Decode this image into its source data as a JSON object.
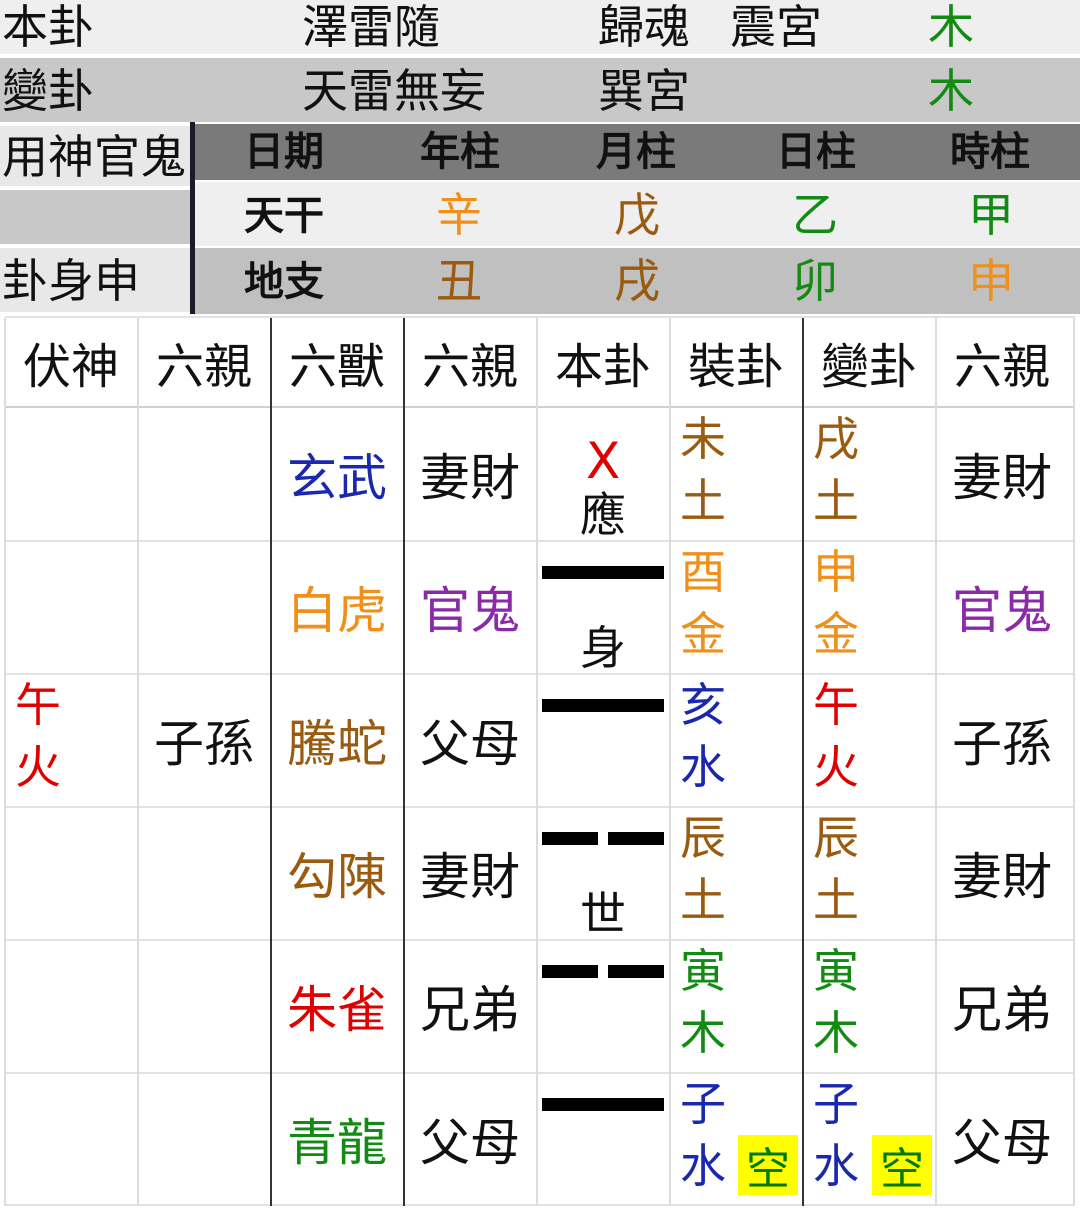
{
  "header": {
    "row1": {
      "label": "本卦",
      "name": "澤雷隨",
      "type": "歸魂",
      "palace": "震宮",
      "element": "木"
    },
    "row2": {
      "label": "變卦",
      "name": "天雷無妄",
      "palace": "巽宮",
      "element": "木"
    },
    "row3": {
      "label": "用神官鬼"
    },
    "row5": {
      "label": "卦身申"
    },
    "pillars": {
      "headers": [
        "日期",
        "年柱",
        "月柱",
        "日柱",
        "時柱"
      ],
      "stem_label": "天干",
      "stems": [
        "辛",
        "戊",
        "乙",
        "甲"
      ],
      "branch_label": "地支",
      "branches": [
        "丑",
        "戌",
        "卯",
        "申"
      ]
    }
  },
  "table": {
    "headers": [
      "伏神",
      "六親",
      "六獸",
      "六親",
      "本卦",
      "裝卦",
      "變卦",
      "六親"
    ],
    "rows": [
      {
        "fushen": [
          "",
          ""
        ],
        "fushen_rel": "",
        "beast": "玄武",
        "rel": "妻財",
        "line_mark": "X",
        "line_label": "應",
        "ben": [
          "未",
          "土"
        ],
        "bian": [
          "戌",
          "土"
        ],
        "bian_rel": "妻財",
        "kong": ""
      },
      {
        "fushen": [
          "",
          ""
        ],
        "fushen_rel": "",
        "beast": "白虎",
        "rel": "官鬼",
        "line_mark": "",
        "line_label": "身",
        "ben": [
          "酉",
          "金"
        ],
        "bian": [
          "申",
          "金"
        ],
        "bian_rel": "官鬼",
        "kong": ""
      },
      {
        "fushen": [
          "午",
          "火"
        ],
        "fushen_rel": "子孫",
        "beast": "騰蛇",
        "rel": "父母",
        "line_mark": "",
        "line_label": "",
        "ben": [
          "亥",
          "水"
        ],
        "bian": [
          "午",
          "火"
        ],
        "bian_rel": "子孫",
        "kong": ""
      },
      {
        "fushen": [
          "",
          ""
        ],
        "fushen_rel": "",
        "beast": "勾陳",
        "rel": "妻財",
        "line_mark": "",
        "line_label": "世",
        "ben": [
          "辰",
          "土"
        ],
        "bian": [
          "辰",
          "土"
        ],
        "bian_rel": "妻財",
        "kong": ""
      },
      {
        "fushen": [
          "",
          ""
        ],
        "fushen_rel": "",
        "beast": "朱雀",
        "rel": "兄弟",
        "line_mark": "",
        "line_label": "",
        "ben": [
          "寅",
          "木"
        ],
        "bian": [
          "寅",
          "木"
        ],
        "bian_rel": "兄弟",
        "kong": ""
      },
      {
        "fushen": [
          "",
          ""
        ],
        "fushen_rel": "",
        "beast": "青龍",
        "rel": "父母",
        "line_mark": "",
        "line_label": "",
        "ben": [
          "子",
          "水"
        ],
        "bian": [
          "子",
          "水"
        ],
        "bian_rel": "父母",
        "kong": "空"
      }
    ]
  },
  "colors": {
    "wood": "#138a13",
    "fire": "#e00000",
    "earth": "#9a5a10",
    "metal": "#f0901a",
    "water": "#1a28b0",
    "purple": "#8a2aa8",
    "kong_bg": "#ffff00"
  }
}
